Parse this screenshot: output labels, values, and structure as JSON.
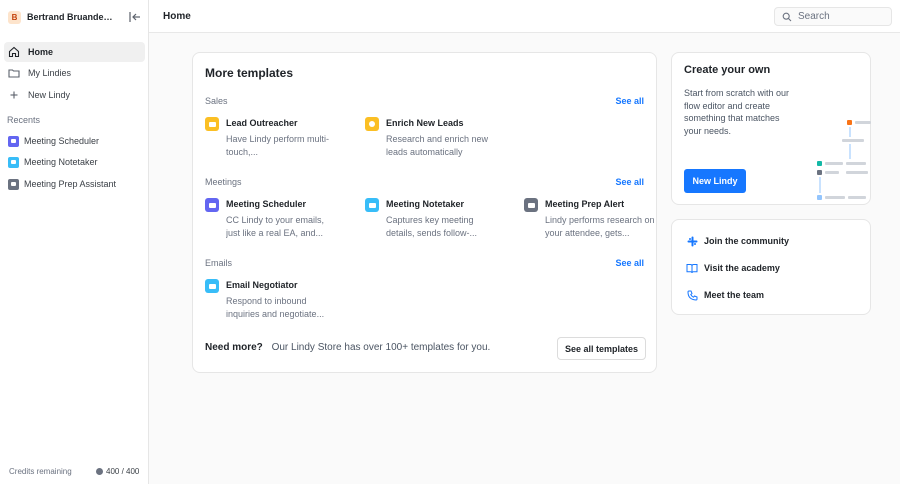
{
  "workspace": {
    "initial": "B",
    "name": "Bertrand Bruandet's..."
  },
  "nav": [
    {
      "label": "Home",
      "icon": "home-icon"
    },
    {
      "label": "My Lindies",
      "icon": "folder-icon"
    },
    {
      "label": "New Lindy",
      "icon": "plus-icon"
    }
  ],
  "recents": {
    "label": "Recents",
    "items": [
      {
        "label": "Meeting Scheduler",
        "color": "#6366f1"
      },
      {
        "label": "Meeting Notetaker",
        "color": "#38bdf8"
      },
      {
        "label": "Meeting Prep Assistant",
        "color": "#6b7280"
      }
    ]
  },
  "credits": {
    "label": "Credits remaining",
    "value": "400 / 400"
  },
  "header": {
    "title": "Home",
    "search_placeholder": "Search"
  },
  "templates": {
    "title": "More templates",
    "see_all": "See all",
    "categories": [
      {
        "label": "Sales",
        "items": [
          {
            "name": "Lead Outreacher",
            "desc": "Have Lindy perform multi-touch,...",
            "color": "#fbbf24"
          },
          {
            "name": "Enrich New Leads",
            "desc": "Research and enrich new leads automatically",
            "color": "#fbbf24"
          }
        ]
      },
      {
        "label": "Meetings",
        "items": [
          {
            "name": "Meeting Scheduler",
            "desc": "CC Lindy to your emails, just like a real EA, and...",
            "color": "#6366f1"
          },
          {
            "name": "Meeting Notetaker",
            "desc": "Captures key meeting details, sends follow-...",
            "color": "#38bdf8"
          },
          {
            "name": "Meeting Prep Alert",
            "desc": "Lindy performs research on your attendee, gets...",
            "color": "#6b7280"
          }
        ]
      },
      {
        "label": "Emails",
        "items": [
          {
            "name": "Email Negotiator",
            "desc": "Respond to inbound inquiries and negotiate...",
            "color": "#38bdf8"
          }
        ]
      }
    ],
    "need_more_bold": "Need more?",
    "need_more_text": "Our Lindy Store has over 100+ templates for you.",
    "see_all_templates": "See all templates"
  },
  "create": {
    "title": "Create your own",
    "desc": "Start from scratch with our flow editor and create something that matches your needs.",
    "button": "New Lindy"
  },
  "links": [
    {
      "label": "Join the community",
      "icon": "slack-icon"
    },
    {
      "label": "Visit the academy",
      "icon": "book-icon"
    },
    {
      "label": "Meet the team",
      "icon": "phone-icon"
    }
  ],
  "colors": {
    "accent": "#1677ff"
  }
}
